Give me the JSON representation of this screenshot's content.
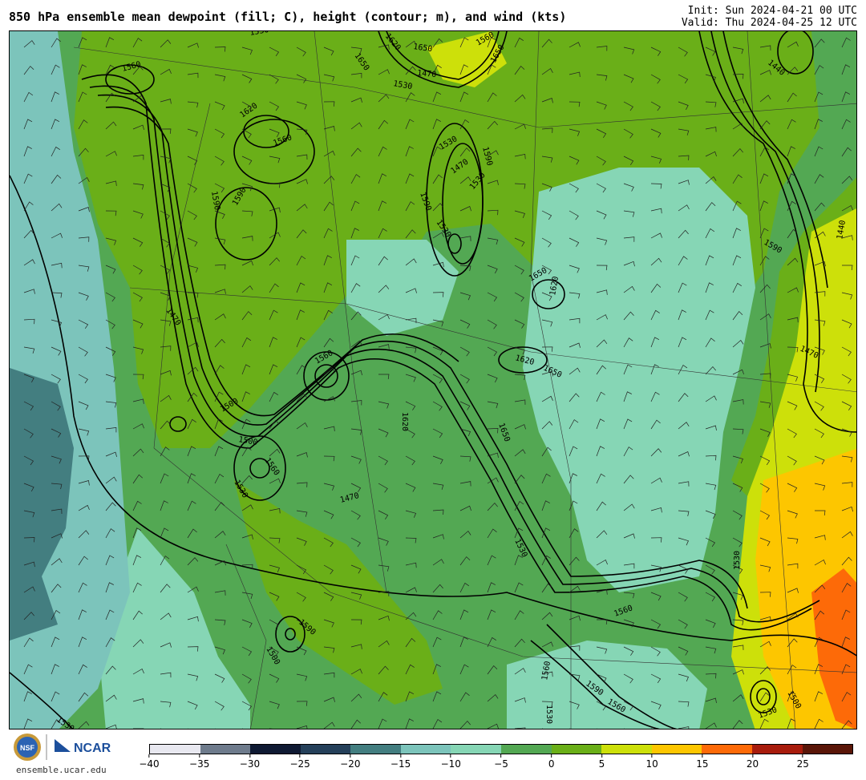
{
  "header": {
    "title": "850 hPa ensemble mean dewpoint (fill; C), height (contour; m), and wind (kts)",
    "init": "Init: Sun 2024-04-21 00 UTC",
    "valid": "Valid: Thu 2024-04-25 12 UTC"
  },
  "footer": {
    "site": "ensemble.ucar.edu",
    "nsf_logo_text": "NSF",
    "ncar_logo_text": "NCAR"
  },
  "colorbar": {
    "colors": [
      "#e8e8f0",
      "#6e7b8c",
      "#0f1a33",
      "#25405a",
      "#437e80",
      "#7cc4bb",
      "#86d6b5",
      "#53a853",
      "#6aaf18",
      "#cde00a",
      "#fdc600",
      "#fd6a08",
      "#a81c0c",
      "#5a1608"
    ],
    "tick_labels": [
      "−40",
      "−35",
      "−30",
      "−25",
      "−20",
      "−15",
      "−10",
      "−5",
      "0",
      "5",
      "10",
      "15",
      "20",
      "25"
    ]
  },
  "map": {
    "fill_colors": {
      "green": "#53a853",
      "light_green": "#6aaf18",
      "mint": "#86d6b5",
      "teal": "#7cc4bb",
      "dark_teal": "#437e80",
      "yellow": "#cde00a",
      "gold": "#fdc600",
      "orange": "#fd6a08"
    },
    "contour_labels": [
      "1560",
      "1620",
      "1530",
      "1650",
      "1470",
      "1530",
      "1560",
      "1650",
      "1650",
      "1620",
      "1560",
      "1530",
      "1590",
      "1530",
      "1470",
      "1590",
      "1530",
      "1590",
      "1590",
      "1470",
      "1440",
      "1590",
      "1440",
      "1650",
      "1620",
      "1620",
      "1650",
      "1470",
      "1560",
      "1500",
      "1620",
      "1650",
      "1500",
      "1560",
      "1530",
      "1470",
      "1530",
      "1530",
      "1500",
      "1560",
      "1590",
      "1560",
      "1590",
      "1530",
      "1560",
      "1500",
      "1530",
      "1530"
    ]
  }
}
